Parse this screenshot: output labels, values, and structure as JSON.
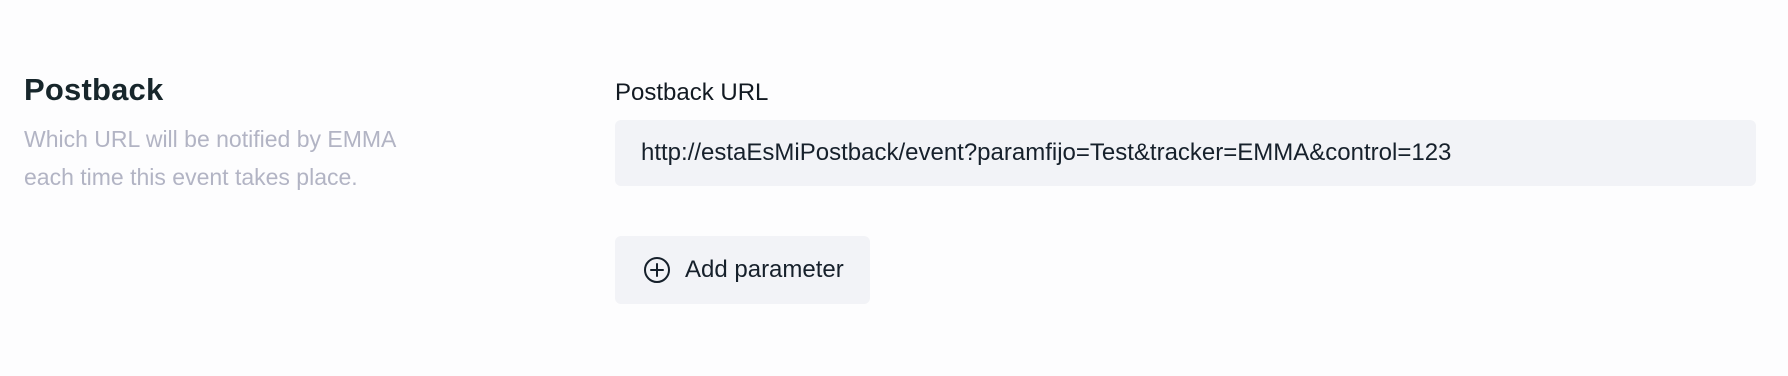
{
  "section": {
    "title": "Postback",
    "description": "Which URL will be notified by EMMA each time this event takes place."
  },
  "postback_url": {
    "label": "Postback URL",
    "value": "http://estaEsMiPostback/event?paramfijo=Test&tracker=EMMA&control=123"
  },
  "add_parameter": {
    "label": "Add parameter",
    "icon": "plus-circle-icon"
  },
  "colors": {
    "title": "#17262b",
    "description": "#b2b4c4",
    "field_background": "#f2f3f7",
    "text": "#16202b"
  }
}
